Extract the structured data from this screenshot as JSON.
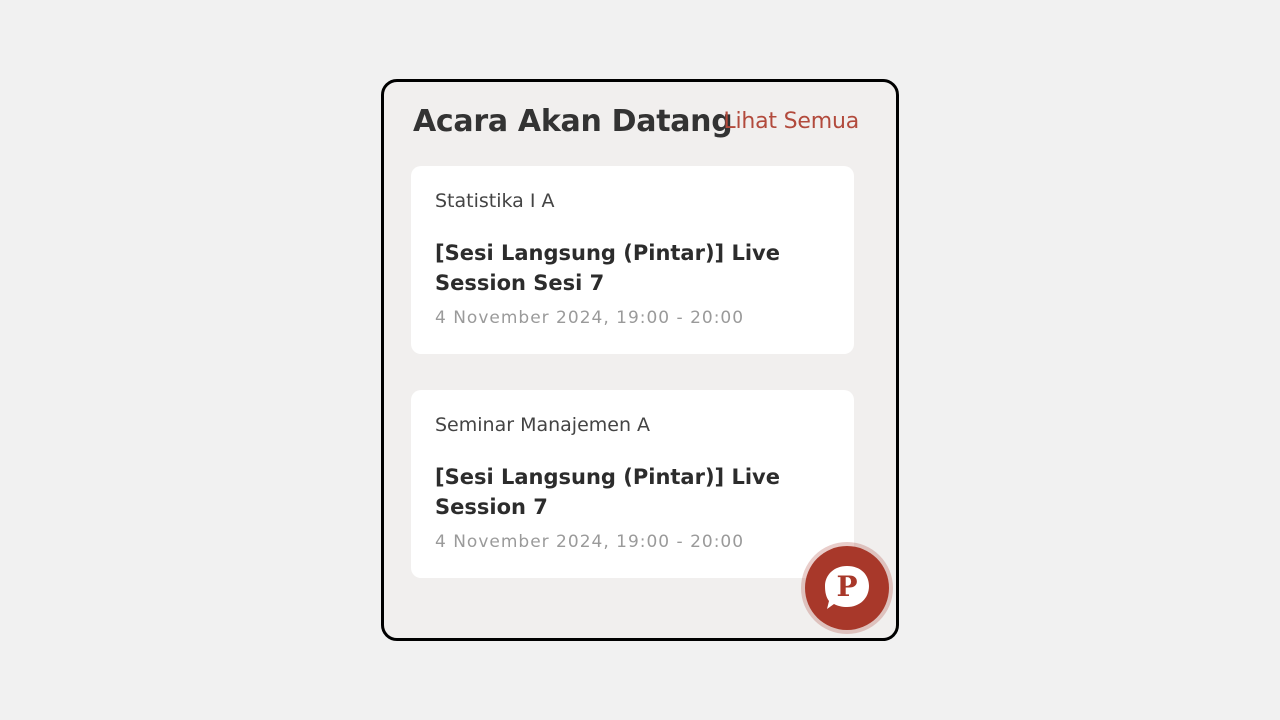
{
  "header": {
    "title": "Acara Akan Datang",
    "see_all_label": "Lihat Semua"
  },
  "events": [
    {
      "course": "Statistika I A",
      "title": "[Sesi Langsung (Pintar)] Live Session Sesi 7",
      "time": "4 November 2024, 19:00 - 20:00"
    },
    {
      "course": "Seminar Manajemen A",
      "title": "[Sesi Langsung (Pintar)] Live Session 7",
      "time": "4 November 2024, 19:00 - 20:00"
    }
  ],
  "fab": {
    "icon": "chat-bubble-p-icon",
    "letter": "P"
  },
  "colors": {
    "accent": "#b24a3c",
    "fab": "#a8382a",
    "panel_bg": "#f1efee"
  }
}
